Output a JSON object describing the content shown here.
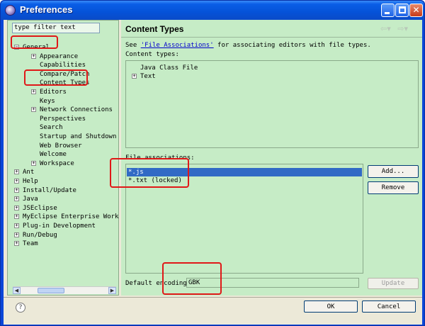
{
  "window": {
    "title": "Preferences"
  },
  "filter": {
    "text": "type filter text"
  },
  "tree": [
    {
      "label": "General",
      "expander": "−"
    },
    {
      "label": "Appearance",
      "expander": "+"
    },
    {
      "label": "Capabilities",
      "expander": ""
    },
    {
      "label": "Compare/Patch",
      "expander": ""
    },
    {
      "label": "Content Types",
      "expander": ""
    },
    {
      "label": "Editors",
      "expander": "+"
    },
    {
      "label": "Keys",
      "expander": ""
    },
    {
      "label": "Network Connections",
      "expander": "+"
    },
    {
      "label": "Perspectives",
      "expander": ""
    },
    {
      "label": "Search",
      "expander": ""
    },
    {
      "label": "Startup and Shutdown",
      "expander": ""
    },
    {
      "label": "Web Browser",
      "expander": ""
    },
    {
      "label": "Welcome",
      "expander": ""
    },
    {
      "label": "Workspace",
      "expander": "+"
    },
    {
      "label": "Ant",
      "expander": "+"
    },
    {
      "label": "Help",
      "expander": "+"
    },
    {
      "label": "Install/Update",
      "expander": "+"
    },
    {
      "label": "Java",
      "expander": "+"
    },
    {
      "label": "JSEclipse",
      "expander": "+"
    },
    {
      "label": "MyEclipse Enterprise Work",
      "expander": "+"
    },
    {
      "label": "Plug-in Development",
      "expander": "+"
    },
    {
      "label": "Run/Debug",
      "expander": "+"
    },
    {
      "label": "Team",
      "expander": "+"
    }
  ],
  "page": {
    "title": "Content Types",
    "see_prefix": "See ",
    "see_link": "'File Associations'",
    "see_suffix": " for associating editors with file types.",
    "content_types_label": "Content types:",
    "content_types": [
      {
        "label": "Java Class File",
        "expander": ""
      },
      {
        "label": "Text",
        "expander": "+"
      }
    ],
    "file_assoc_label": "File associations:",
    "file_assoc": [
      {
        "label": "*.js",
        "selected": true
      },
      {
        "label": "*.txt (locked)",
        "selected": false
      }
    ],
    "add_button": "Add...",
    "remove_button": "Remove",
    "encoding_label": "Default encoding:",
    "encoding_value": "GBK",
    "update_button": "Update"
  },
  "footer": {
    "ok": "OK",
    "cancel": "Cancel",
    "help": "?"
  },
  "colors": {
    "annotation": "#e01818",
    "selection": "#316ac5",
    "pane": "#c6ecc6"
  }
}
